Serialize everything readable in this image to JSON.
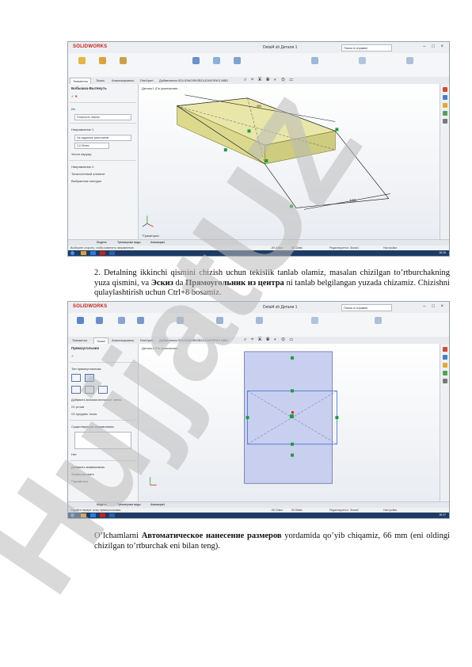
{
  "shot1": {
    "app_logo": "SOLIDWORKS",
    "doc_title": "Detal4 sh Детали 1",
    "search_placeholder": "Поиск в справке",
    "tabs": [
      "Элементы",
      "Эскиз",
      "Анализировать",
      "DimXpert",
      "Добавления SOLIDWORKS",
      "SOLIDWORKS MBD"
    ],
    "active_tab": 0,
    "tree_root": "Деталь1 (По умолчанию...",
    "feature_title": "Бобышка-Вытянуть",
    "panel_items": [
      "Из",
      "Плоскость эскиза",
      "Направление 1",
      "На заданное расстояние",
      "2.0.00mm",
      "Уклон наружу",
      "Направление 2",
      "Тонкостенный элемент",
      "Выбранные контуры"
    ],
    "view_label": "*Триметрия",
    "bottom_tabs": [
      "Модель",
      "Трехмерные виды",
      "Анимация1"
    ],
    "status_left": "Выберите сторону, чтобы изменить направление.",
    "status_right": [
      "-59.43мм",
      "86.32мм",
      "Редактируется: Эскиз1",
      "Настройка"
    ],
    "clock": "18:16"
  },
  "shot2": {
    "app_logo": "SOLIDWORKS",
    "doc_title": "Detal4 sh Детали 1",
    "search_placeholder": "Поиск в справке",
    "tabs": [
      "Элементы",
      "Эскиз",
      "Анализировать",
      "DimXpert",
      "Добавления SOLIDWORKS",
      "SOLIDWORKS MBD"
    ],
    "active_tab": 1,
    "tree_root": "Деталь1 (По умолчанию...",
    "feature_title": "Прямоугольник",
    "panel_items": [
      "Тип прямоугольника",
      "Добавить вспомогательные линии",
      "От углов",
      "От средних точек",
      "Существующие взаимосвязи",
      "Нет",
      "Добавить взаимосвязь",
      "Зафиксировать",
      "Параметры"
    ],
    "view_label": "",
    "bottom_tabs": [
      "Модель",
      "Трехмерные виды",
      "Анимация1"
    ],
    "status_left": "Задайте первую точку прямоугольника.",
    "status_right": [
      "-96.22мм",
      "50.50мм",
      "Редактируется: Эскиз2",
      "Настройка"
    ],
    "clock": "18:17"
  },
  "para1": {
    "part1": "2. Detalning ikkinchi qismini chizish uchun tekislik tanlab olamiz, masalan chizilgan to’rtburchakning yuza qismini, va ",
    "bold1": "Эскиз",
    "part2": " da ",
    "bold2": "Прямоугольник из центра",
    "part3": " ni tanlab belgilangan yuzada chizamiz. Chizishni qulaylashtirish uchun Ctrl+8 bosamiz."
  },
  "para2": {
    "part1": "O’lchamlarni ",
    "bold1": "Автоматическое нанесение размеров",
    "part2": " yordamida qo’yib chiqamiz, 66 mm (eni oldingi chizilgan to’rtburchak eni bilan teng)."
  },
  "dimension_labels": [
    "66",
    "180"
  ],
  "watermark": "HujjatUZ",
  "colors": {
    "accent_red": "#c6201f",
    "sketch_blue": "#3b6fd1",
    "sketch_fill": "#c9cfee",
    "plane_yellow": "#e6e39a",
    "watermark_gray": "#b9b9b9",
    "watermark_purple": "#9b4fd6"
  }
}
